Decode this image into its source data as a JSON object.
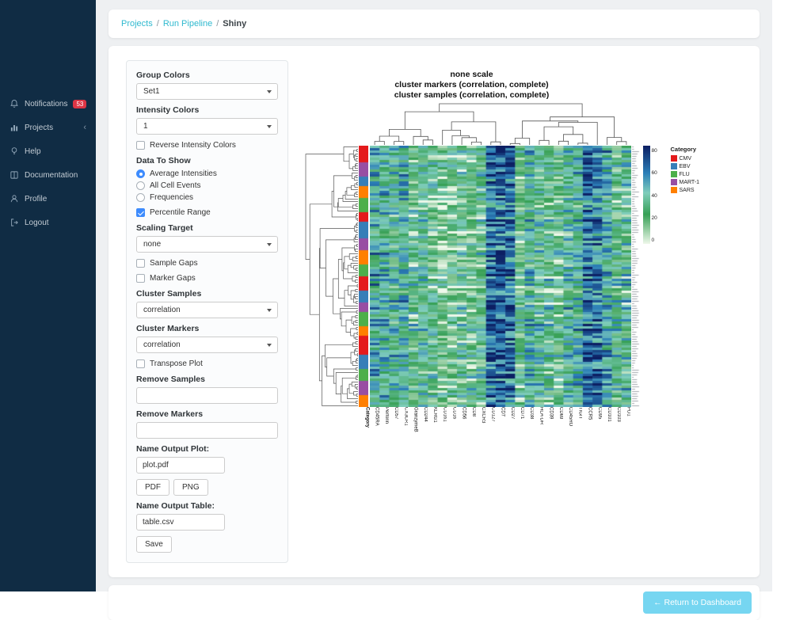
{
  "sidebar": {
    "items": [
      {
        "label": "Notifications",
        "icon": "bell-icon",
        "badge": "53"
      },
      {
        "label": "Projects",
        "icon": "bar-chart-icon",
        "chevron": "‹"
      },
      {
        "label": "Help",
        "icon": "help-icon"
      },
      {
        "label": "Documentation",
        "icon": "book-icon"
      },
      {
        "label": "Profile",
        "icon": "person-icon"
      },
      {
        "label": "Logout",
        "icon": "logout-icon"
      }
    ]
  },
  "breadcrumb": {
    "separator": "/",
    "items": [
      "Projects",
      "Run Pipeline",
      "Shiny"
    ]
  },
  "controls": {
    "group_colors": {
      "label": "Group Colors",
      "value": "Set1"
    },
    "intensity_colors": {
      "label": "Intensity Colors",
      "value": "1"
    },
    "reverse_intensity": {
      "label": "Reverse Intensity Colors",
      "checked": false
    },
    "data_to_show": {
      "label": "Data To Show",
      "options": [
        {
          "label": "Average Intensities",
          "selected": true
        },
        {
          "label": "All Cell Events",
          "selected": false
        },
        {
          "label": "Frequencies",
          "selected": false
        }
      ]
    },
    "percentile_range": {
      "label": "Percentile Range",
      "checked": true
    },
    "scaling_target": {
      "label": "Scaling Target",
      "value": "none"
    },
    "sample_gaps": {
      "label": "Sample Gaps",
      "checked": false
    },
    "marker_gaps": {
      "label": "Marker Gaps",
      "checked": false
    },
    "cluster_samples": {
      "label": "Cluster Samples",
      "value": "correlation"
    },
    "cluster_markers": {
      "label": "Cluster Markers",
      "value": "correlation"
    },
    "transpose_plot": {
      "label": "Transpose Plot",
      "checked": false
    },
    "remove_samples": {
      "label": "Remove Samples",
      "value": ""
    },
    "remove_markers": {
      "label": "Remove Markers",
      "value": ""
    },
    "name_output_plot": {
      "label": "Name Output Plot:",
      "value": "plot.pdf"
    },
    "pdf_button": "PDF",
    "png_button": "PNG",
    "name_output_table": {
      "label": "Name Output Table:",
      "value": "table.csv"
    },
    "save_button": "Save"
  },
  "footer": {
    "return_button": "← Return to Dashboard"
  },
  "chart_data": {
    "type": "heatmap",
    "title_lines": [
      "none scale",
      "cluster markers (correlation, complete)",
      "cluster samples (correlation, complete)"
    ],
    "category_label": "Category",
    "columns": [
      "CD45RA",
      "Perforin",
      "CD57",
      "CX3CR1",
      "GranzymeB",
      "CD244",
      "KLRG1",
      "CD161",
      "CD16",
      "CD56",
      "CD8",
      "CXCR3",
      "CD127",
      "CD7",
      "CD27",
      "CD71",
      "CD38",
      "HLA-DR",
      "CD39",
      "CD69",
      "CD45RO",
      "TIGIT",
      "CCR5",
      "CD95",
      "CD101",
      "CD103",
      "PD1"
    ],
    "column_mean_intensity": [
      48,
      44,
      40,
      44,
      28,
      34,
      30,
      22,
      22,
      26,
      26,
      30,
      66,
      70,
      66,
      26,
      42,
      34,
      30,
      26,
      38,
      42,
      66,
      62,
      46,
      30,
      34
    ],
    "row_count": 110,
    "intensity_scale": {
      "min": 0,
      "max": 85,
      "ticks": [
        "80",
        "60",
        "40",
        "20",
        "0"
      ],
      "stops": [
        {
          "t": 0.0,
          "color": "#eef8ea"
        },
        {
          "t": 0.3,
          "color": "#37a055"
        },
        {
          "t": 0.52,
          "color": "#7fcdbb"
        },
        {
          "t": 0.72,
          "color": "#2c7fb8"
        },
        {
          "t": 1.0,
          "color": "#0c1f63"
        }
      ]
    },
    "category_legend": {
      "title": "Category",
      "entries": [
        {
          "label": "CMV",
          "color": "#e41a1c"
        },
        {
          "label": "EBV",
          "color": "#377eb8"
        },
        {
          "label": "FLU",
          "color": "#4daf4a"
        },
        {
          "label": "MART-1",
          "color": "#984ea3"
        },
        {
          "label": "SARS",
          "color": "#ff7f00"
        }
      ]
    },
    "category_strip_segments": [
      {
        "category": "CMV",
        "rows": 7
      },
      {
        "category": "MART-1",
        "rows": 6
      },
      {
        "category": "EBV",
        "rows": 4
      },
      {
        "category": "SARS",
        "rows": 5
      },
      {
        "category": "FLU",
        "rows": 6
      },
      {
        "category": "CMV",
        "rows": 4
      },
      {
        "category": "EBV",
        "rows": 7
      },
      {
        "category": "MART-1",
        "rows": 5
      },
      {
        "category": "SARS",
        "rows": 6
      },
      {
        "category": "FLU",
        "rows": 5
      },
      {
        "category": "CMV",
        "rows": 6
      },
      {
        "category": "EBV",
        "rows": 5
      },
      {
        "category": "MART-1",
        "rows": 4
      },
      {
        "category": "FLU",
        "rows": 6
      },
      {
        "category": "SARS",
        "rows": 4
      },
      {
        "category": "CMV",
        "rows": 8
      },
      {
        "category": "EBV",
        "rows": 6
      },
      {
        "category": "FLU",
        "rows": 5
      },
      {
        "category": "MART-1",
        "rows": 6
      },
      {
        "category": "SARS",
        "rows": 5
      }
    ]
  }
}
